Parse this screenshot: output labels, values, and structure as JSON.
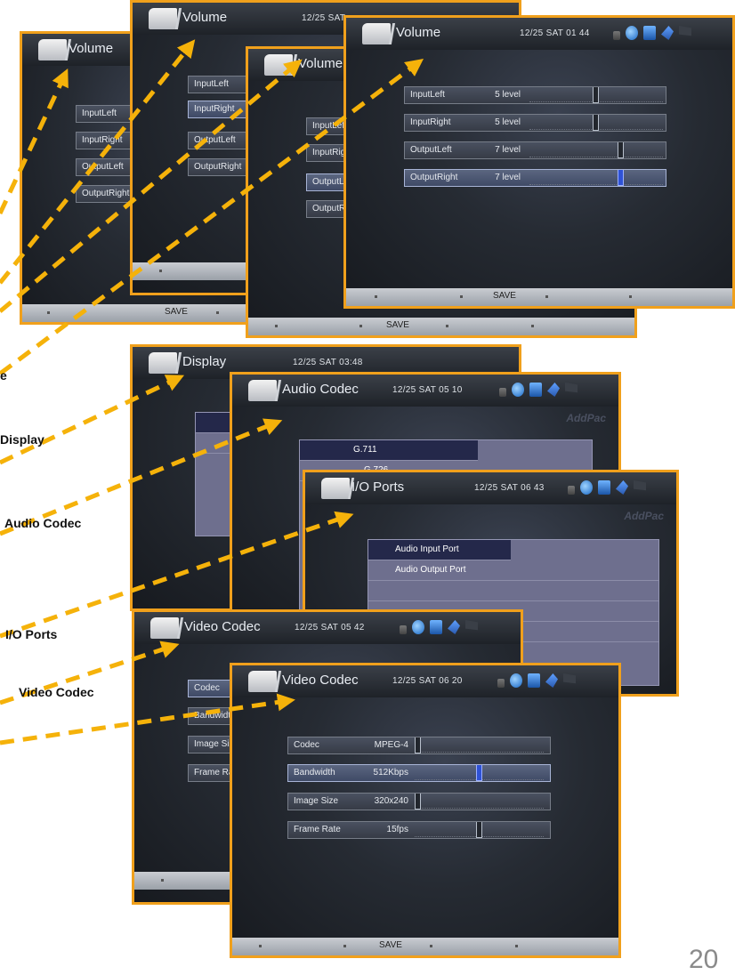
{
  "status": {
    "icons": [
      "lock-icon",
      "globe-icon",
      "screen-icon",
      "share-icon",
      "flag-icon"
    ]
  },
  "screens": {
    "volume1": {
      "title": "Volume",
      "rows": [
        "InputLeft",
        "InputRight",
        "OutputLeft",
        "OutputRight"
      ],
      "save": "SAVE"
    },
    "volume2": {
      "title": "Volume",
      "date": "12/25 SAT",
      "rows": [
        "InputLeft",
        "InputRight",
        "OutputLeft",
        "OutputRight"
      ]
    },
    "volume3": {
      "title": "Volume",
      "rows": [
        "InputLeft",
        "InputRight",
        "OutputLeft",
        "OutputRight"
      ],
      "save": "SAVE"
    },
    "volume4": {
      "title": "Volume",
      "date": "12/25 SAT 01 44",
      "rows": [
        {
          "label": "InputLeft",
          "value": "5 level",
          "level": 0.5
        },
        {
          "label": "InputRight",
          "value": "5 level",
          "level": 0.5
        },
        {
          "label": "OutputLeft",
          "value": "7 level",
          "level": 0.7
        },
        {
          "label": "OutputRight",
          "value": "7 level",
          "level": 0.7
        }
      ],
      "save": "SAVE"
    },
    "display": {
      "title": "Display",
      "date": "12/25 SAT 03:48"
    },
    "audio": {
      "title": "Audio Codec",
      "date": "12/25 SAT 05 10",
      "brand": "AddPac",
      "items": [
        "G.711",
        "G.726"
      ]
    },
    "io": {
      "title": "I/O Ports",
      "date": "12/25 SAT 06 43",
      "brand": "AddPac",
      "items": [
        "Audio Input Port",
        "Audio Output Port"
      ]
    },
    "video1": {
      "title": "Video Codec",
      "date": "12/25 SAT 05 42",
      "rows": [
        "Codec",
        "Bandwidth",
        "Image Size",
        "Frame Rate"
      ]
    },
    "video2": {
      "title": "Video Codec",
      "date": "12/25 SAT 06 20",
      "rows": [
        {
          "label": "Codec",
          "value": "MPEG-4",
          "level": 0.0
        },
        {
          "label": "Bandwidth",
          "value": "512Kbps",
          "level": 0.5
        },
        {
          "label": "Image Size",
          "value": "320x240",
          "level": 0.0
        },
        {
          "label": "Frame Rate",
          "value": "15fps",
          "level": 0.5
        }
      ],
      "save": "SAVE"
    }
  },
  "callouts": {
    "volume_partial": "e",
    "display": "Display",
    "audio": "Audio Codec",
    "io": "I/O Ports",
    "video": "Video Codec"
  },
  "page_number": "20"
}
